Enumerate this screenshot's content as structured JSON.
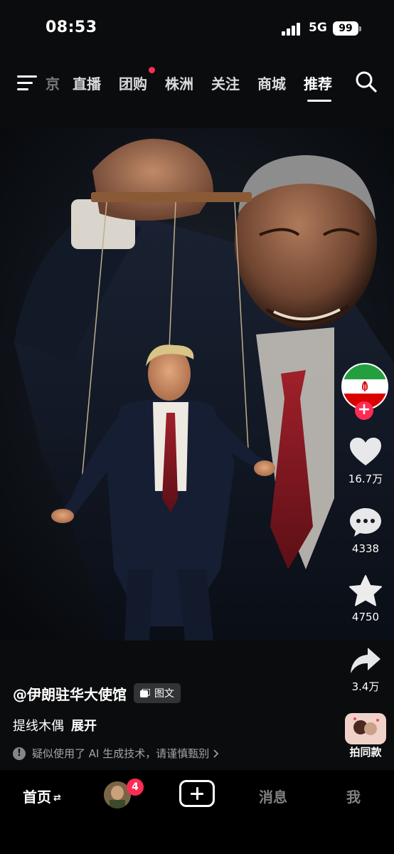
{
  "status_bar": {
    "time": "08:53",
    "network": "5G",
    "battery": "99"
  },
  "top_nav": {
    "faded_tab": "京",
    "tabs": [
      {
        "label": "直播"
      },
      {
        "label": "团购",
        "has_dot": true
      },
      {
        "label": "株洲"
      },
      {
        "label": "关注"
      },
      {
        "label": "商城"
      },
      {
        "label": "推荐",
        "active": true
      }
    ]
  },
  "actions": {
    "likes": "16.7万",
    "comments": "4338",
    "favorites": "4750",
    "shares": "3.4万",
    "remix_label": "拍同款"
  },
  "caption": {
    "author": "@伊朗驻华大使馆",
    "type_badge": "图文",
    "description": "提线木偶",
    "expand": "展开",
    "ai_notice": "疑似使用了 AI 生成技术，请谨慎甄别"
  },
  "tab_bar": {
    "home": "首页",
    "friend_badge": "4",
    "messages": "消息",
    "me": "我"
  },
  "colors": {
    "accent": "#fe2c55",
    "background": "#0b0c0e"
  }
}
